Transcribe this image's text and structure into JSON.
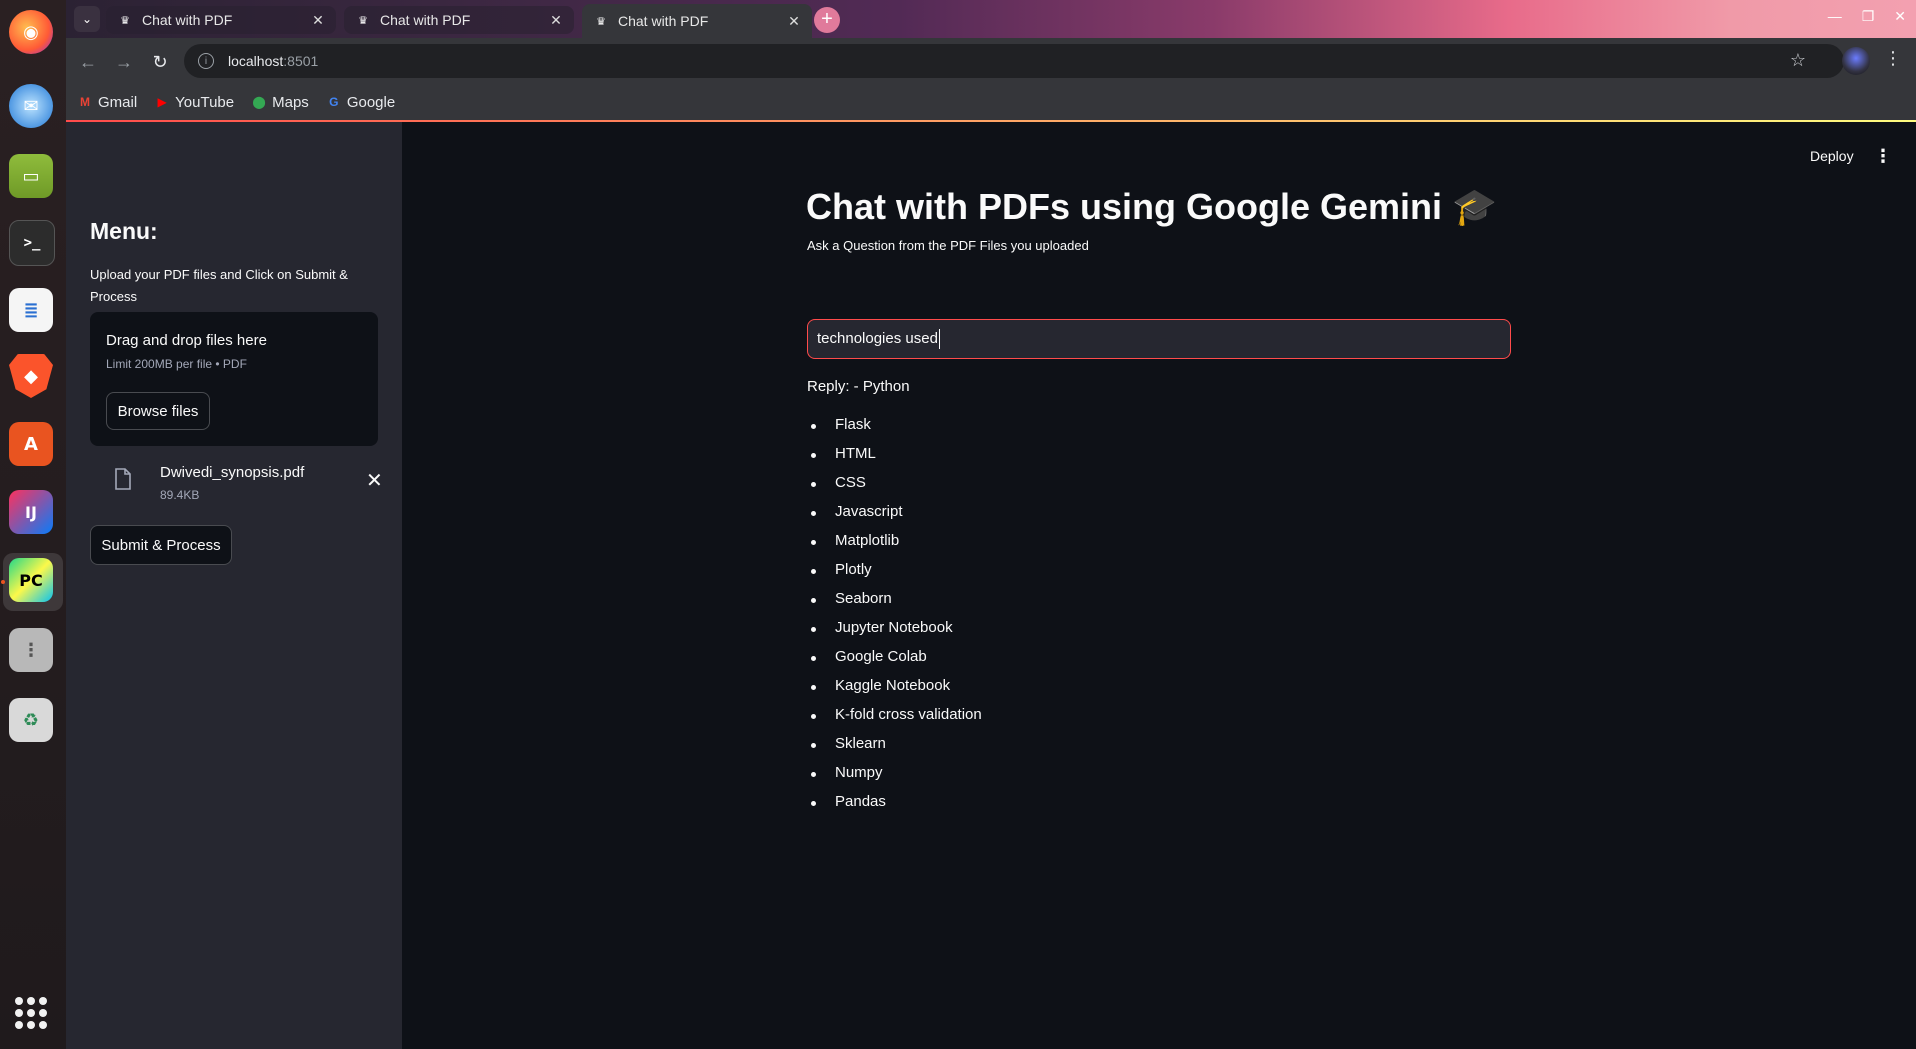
{
  "browser": {
    "tabs": [
      {
        "title": "Chat with PDF",
        "active": false
      },
      {
        "title": "Chat with PDF",
        "active": false
      },
      {
        "title": "Chat with PDF",
        "active": true
      }
    ],
    "address": {
      "host": "localhost",
      "port": ":8501"
    },
    "bookmarks": [
      "Gmail",
      "YouTube",
      "Maps",
      "Google"
    ]
  },
  "dock": {
    "apps": [
      "firefox",
      "thunderbird",
      "files",
      "terminal",
      "libreoffice-writer",
      "brave",
      "app-center",
      "intellij-idea",
      "pycharm",
      "settings",
      "trash"
    ]
  },
  "app": {
    "toolbar": {
      "deploy_label": "Deploy",
      "menu_glyph": "⋮"
    },
    "sidebar": {
      "title": "Menu:",
      "instructions": "Upload your PDF files and Click on Submit & Process",
      "uploader": {
        "drop_label": "Drag and drop files here",
        "limit_label": "Limit 200MB per file • PDF",
        "browse_label": "Browse files"
      },
      "uploaded_file": {
        "name": "Dwivedi_synopsis.pdf",
        "size": "89.4KB"
      },
      "submit_label": "Submit & Process"
    },
    "main": {
      "title": "Chat with PDFs using Google Gemini 🎓",
      "question_label": "Ask a Question from the PDF Files you uploaded",
      "question_value": "technologies used",
      "reply_intro": "Reply: - Python",
      "reply_items": [
        "Flask",
        "HTML",
        "CSS",
        "Javascript",
        "Matplotlib",
        "Plotly",
        "Seaborn",
        "Jupyter Notebook",
        "Google Colab",
        "Kaggle Notebook",
        "K-fold cross validation",
        "Sklearn",
        "Numpy",
        "Pandas"
      ]
    }
  },
  "colors": {
    "accent": "#ff4b4b",
    "background": "#0e1117",
    "sidebar": "#262730",
    "text": "#fafafa"
  }
}
